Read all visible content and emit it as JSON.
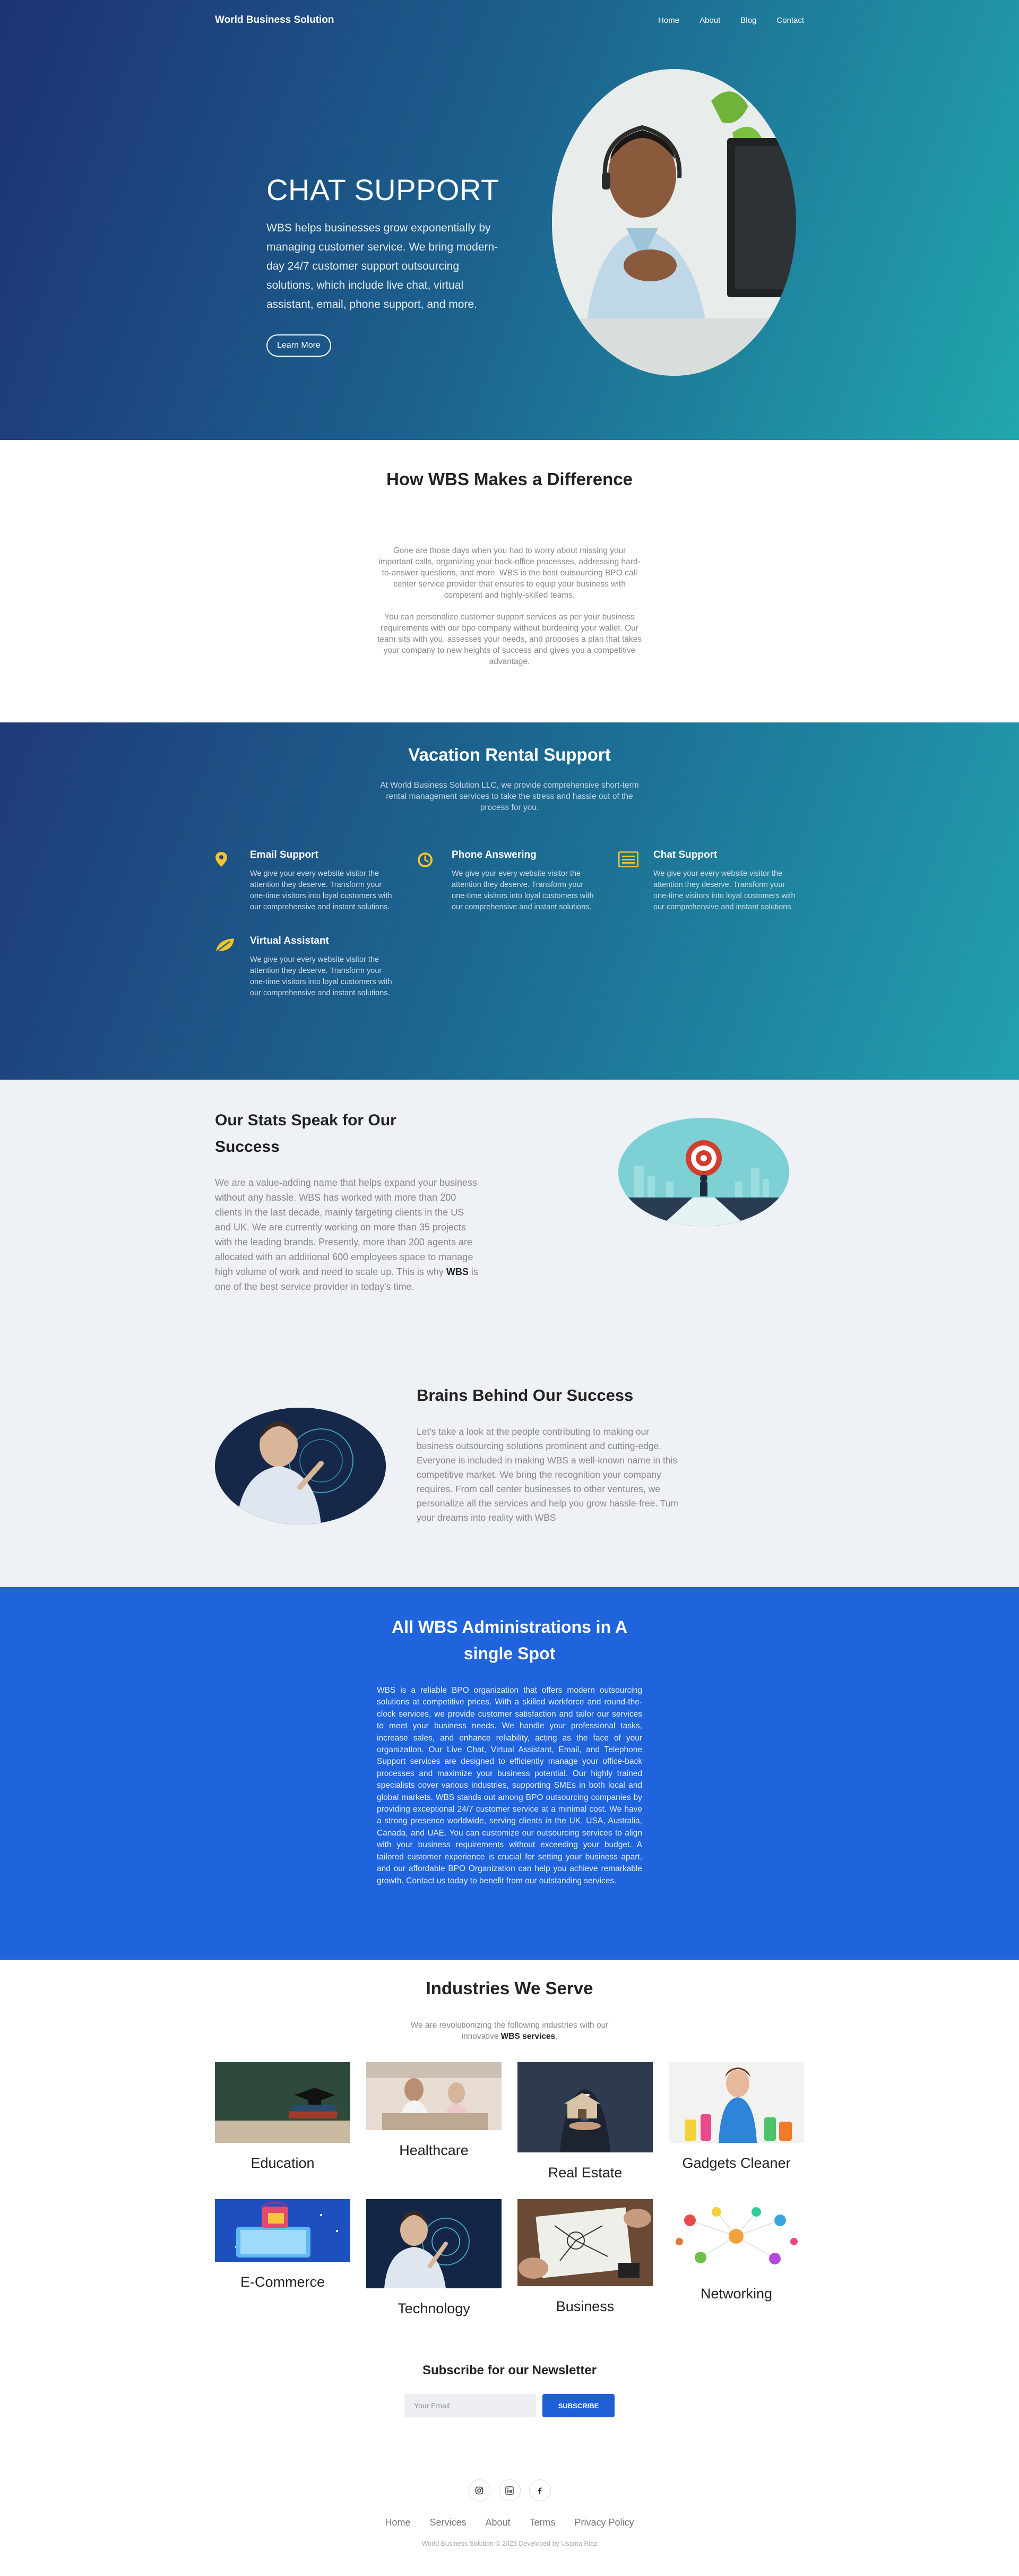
{
  "brand": "World Business Solution",
  "nav": [
    "Home",
    "About",
    "Blog",
    "Contact"
  ],
  "hero": {
    "title": "CHAT SUPPORT",
    "text": "WBS helps businesses grow exponentially by managing customer service. We bring modern-day 24/7 customer support outsourcing solutions, which include live chat, virtual assistant, email, phone support, and more.",
    "button": "Learn More"
  },
  "difference": {
    "title": "How WBS Makes a Difference",
    "p1": "Gone are those days when you had to worry about missing your important calls, organizing your back-office processes, addressing hard-to-answer questions, and more. WBS is the best outsourcing BPO call center service provider that ensures to equip your business with competent and highly-skilled teams.",
    "p2": "You can personalize customer support services as per your business requirements with our bpo company without burdening your wallet. Our team sits with you, assesses your needs, and proposes a plan that takes your company to new heights of success and gives you a competitive advantage."
  },
  "vacation": {
    "title": "Vacation Rental Support",
    "subtitle": "At World Business Solution LLC, we provide comprehensive short-term rental management services to take the stress and hassle out of the process for you.",
    "features": [
      {
        "title": "Email Support",
        "icon": "map-pin-icon",
        "text": "We give your every website visitor the attention they deserve. Transform your one-time visitors into loyal customers with our comprehensive and instant solutions."
      },
      {
        "title": "Phone Answering",
        "icon": "clock-icon",
        "text": "We give your every website visitor the attention they deserve. Transform your one-time visitors into loyal customers with our comprehensive and instant solutions."
      },
      {
        "title": "Chat Support",
        "icon": "list-icon",
        "text": "We give your every website visitor the attention they deserve. Transform your one-time visitors into loyal customers with our comprehensive and instant solutions."
      },
      {
        "title": "Virtual Assistant",
        "icon": "leaf-icon",
        "text": "We give your every website visitor the attention they deserve. Transform your one-time visitors into loyal customers with our comprehensive and instant solutions."
      }
    ]
  },
  "stats": {
    "title": "Our Stats Speak for Our Success",
    "text_before": "We are a value-adding name that helps expand your business without any hassle. WBS has worked with more than 200 clients in the last decade, mainly targeting clients in the US and UK. We are currently working on more than 35 projects with the leading brands. Presently, more than 200 agents are allocated with an additional 600 employees space to manage high volume of work and need to scale up. This is why ",
    "text_bold": "WBS",
    "text_after": " is one of the best  service provider in today's time."
  },
  "brains": {
    "title": "Brains Behind Our Success",
    "text": "Let's take a look at the people contributing to making our business outsourcing solutions prominent and cutting-edge. Everyone is included in making WBS a well-known name in this competitive market. We bring the recognition your company requires. From call center businesses to other ventures, we personalize all the services and help you grow hassle-free. Turn your dreams into reality with WBS"
  },
  "all_wbs": {
    "title": "All WBS Administrations in A single Spot",
    "text": "WBS is a reliable BPO organization that offers modern outsourcing solutions at competitive prices. With a skilled workforce and round-the-clock services, we provide customer satisfaction and tailor our services to meet your business needs. We handle your professional tasks, increase sales, and enhance reliability, acting as the face of your organization. Our Live Chat, Virtual Assistant, Email, and Telephone Support services are designed to efficiently manage your office-back processes and maximize your business potential. Our highly trained specialists cover various industries, supporting SMEs in both local and global markets. WBS stands out among BPO outsourcing companies by providing exceptional 24/7 customer service at a minimal cost. We have a strong presence worldwide, serving clients in the UK, USA, Australia, Canada, and UAE. You can customize our outsourcing services to align with your business requirements without exceeding your budget. A tailored customer experience is crucial for setting your business apart, and our affordable BPO Organization can help you achieve remarkable growth. Contact us today to benefit from our outstanding services."
  },
  "industries": {
    "title": "Industries We Serve",
    "subtitle_before": "We are revolutionizing the following industries with our innovative ",
    "subtitle_bold": "WBS services",
    "subtitle_after": ".",
    "items": [
      "Education",
      "Healthcare",
      "Real Estate",
      "Gadgets Cleaner",
      "E-Commerce",
      "Technology",
      "Business",
      "Networking"
    ]
  },
  "newsletter": {
    "title": "Subscribe for our Newsletter",
    "placeholder": "Your Email",
    "button": "SUBSCRIBE"
  },
  "footer": {
    "social": [
      "instagram-icon",
      "linkedin-icon",
      "facebook-icon"
    ],
    "links": [
      "Home",
      "Services",
      "About",
      "Terms",
      "Privacy Policy"
    ],
    "copyright": "World Business Solution © 2023 Developed by Usama Riaz"
  },
  "colors": {
    "hero_start": "#1e3272",
    "hero_end": "#21a7ae",
    "accent_yellow": "#f2c42b",
    "admin_blue": "#1f64dc",
    "subscribe_blue": "#1f5fd6",
    "section_gray": "#eef1f5"
  }
}
